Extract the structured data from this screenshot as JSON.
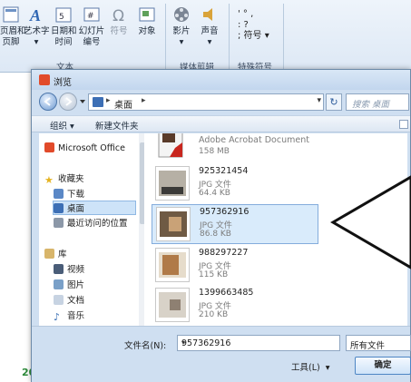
{
  "ribbon": {
    "buttons": [
      {
        "label": "页眉和\n页脚",
        "icon": "header-icon"
      },
      {
        "label": "艺术字\n▾",
        "icon": "wordart-icon"
      },
      {
        "label": "日期和\n时间",
        "icon": "datetime-icon"
      },
      {
        "label": "幻灯片\n编号",
        "icon": "slide-number-icon"
      },
      {
        "label": "符号",
        "icon": "omega-icon"
      },
      {
        "label": "对象",
        "icon": "object-icon"
      },
      {
        "label": "影片\n▾",
        "icon": "film-icon"
      },
      {
        "label": "声音\n▾",
        "icon": "sound-icon"
      }
    ],
    "symbols_text": "' ° ,\n: ?\n; 符号 ▾",
    "groups": {
      "text": "文本",
      "media": "媒体剪辑",
      "special": "特殊符号"
    }
  },
  "background": {
    "year_text": "20"
  },
  "dialog": {
    "title": "浏览",
    "address_crumb": "桌面",
    "search_placeholder": "搜索 桌面",
    "toolbar": {
      "organize": "组织 ▾",
      "new_folder": "新建文件夹"
    },
    "nav": {
      "microsoft_office": "Microsoft Office",
      "favorites": "收藏夹",
      "downloads": "下载",
      "desktop": "桌面",
      "recent": "最近访问的位置",
      "libraries": "库",
      "videos": "视频",
      "pictures": "图片",
      "documents": "文档",
      "music": "音乐"
    },
    "files": [
      {
        "name": "Adobe Acrobat Document",
        "type": "",
        "size": "158 MB"
      },
      {
        "name": "925321454",
        "type": "JPG 文件",
        "size": "64.4 KB"
      },
      {
        "name": "957362916",
        "type": "JPG 文件",
        "size": "86.8 KB"
      },
      {
        "name": "988297227",
        "type": "JPG 文件",
        "size": "115 KB"
      },
      {
        "name": "1399663485",
        "type": "JPG 文件",
        "size": "210 KB"
      }
    ],
    "filename_label": "文件名(N):",
    "filename_value": "957362916",
    "filetype_value": "所有文件",
    "tools_label": "工具(L)  ▾",
    "open_label": "确定"
  },
  "colors": {
    "ribbon_bg": "#dde8f5",
    "dialog_bg": "#cfdff1",
    "selection": "#d9ebfb",
    "accent": "#4e86c4"
  }
}
